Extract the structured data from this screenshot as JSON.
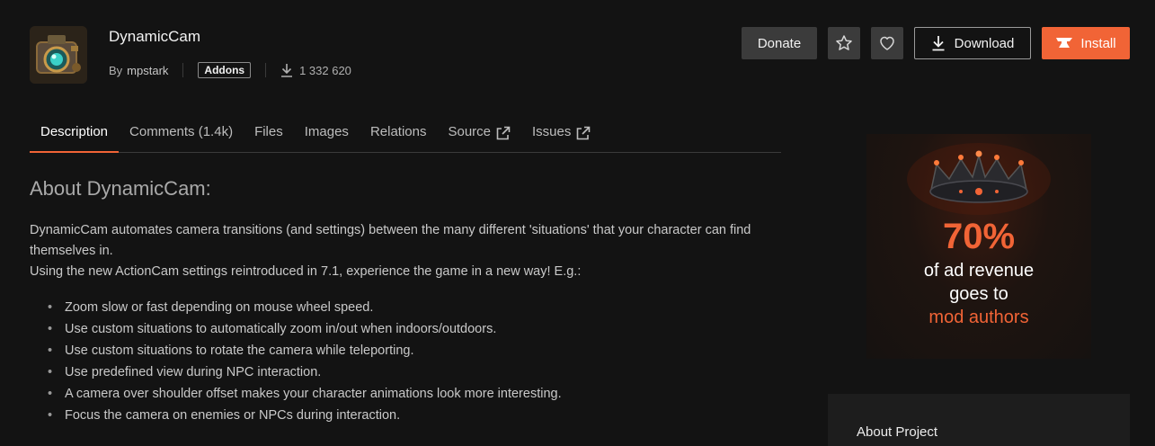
{
  "addon": {
    "title": "DynamicCam",
    "by_label": "By",
    "author": "mpstark",
    "category": "Addons",
    "downloads": "1 332 620"
  },
  "actions": {
    "donate": "Donate",
    "download": "Download",
    "install": "Install"
  },
  "tabs": [
    {
      "label": "Description",
      "active": true
    },
    {
      "label": "Comments (1.4k)"
    },
    {
      "label": "Files"
    },
    {
      "label": "Images"
    },
    {
      "label": "Relations"
    },
    {
      "label": "Source",
      "external": true
    },
    {
      "label": "Issues",
      "external": true
    }
  ],
  "description": {
    "heading": "About DynamicCam:",
    "paragraph1": "DynamicCam automates camera transitions (and settings) between the many different 'situations' that your character can find themselves in.",
    "paragraph2": "Using the new ActionCam settings reintroduced in 7.1, experience the game in a new way! E.g.:",
    "bullets": [
      "Zoom slow or fast depending on mouse wheel speed.",
      "Use custom situations to automatically zoom in/out when indoors/outdoors.",
      "Use custom situations to rotate the camera while teleporting.",
      "Use predefined view during NPC interaction.",
      "A camera over shoulder offset makes your character animations look more interesting.",
      "Focus the camera on enemies or NPCs during interaction."
    ]
  },
  "ad": {
    "percent": "70%",
    "line1": "of ad revenue",
    "line2": "goes to",
    "line3": "mod authors"
  },
  "sidebar": {
    "about_project": "About Project"
  },
  "colors": {
    "accent": "#f16436",
    "background": "#131313",
    "button_gray": "#3b3b3b"
  }
}
